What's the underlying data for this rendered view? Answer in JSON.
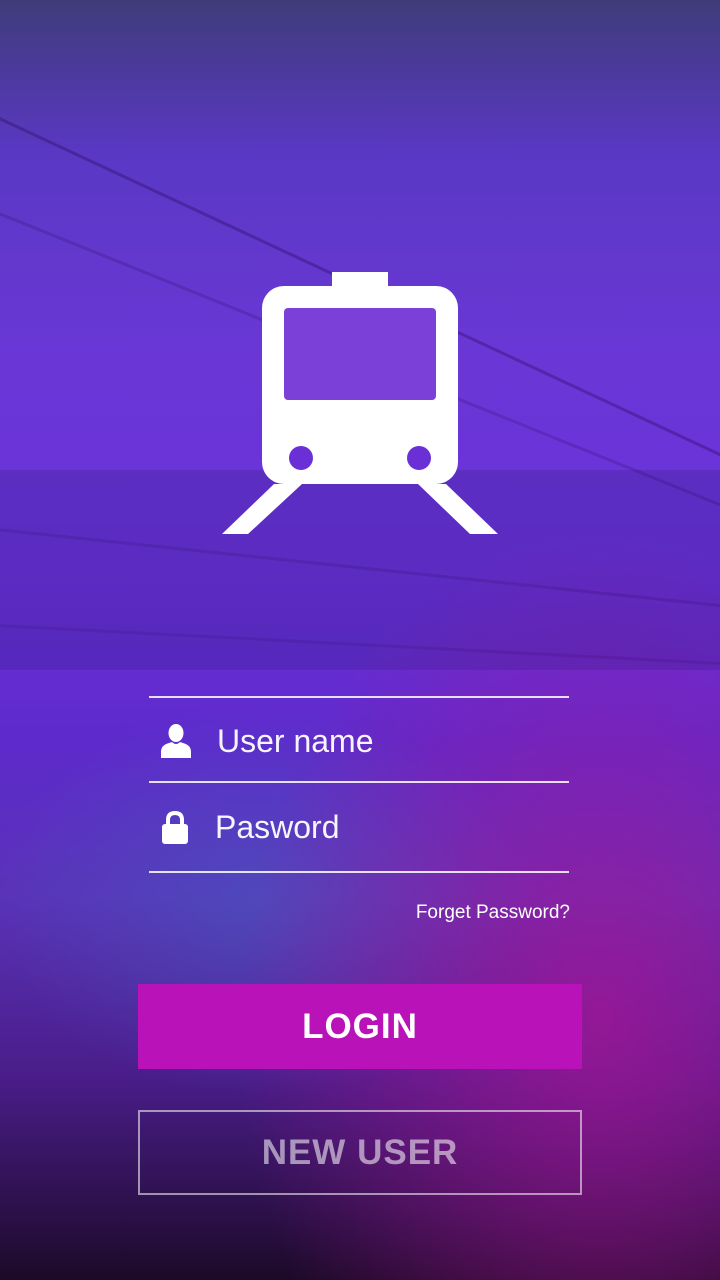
{
  "form": {
    "username_placeholder": "User name",
    "username_value": "",
    "password_placeholder": "Pasword",
    "password_value": "",
    "forgot_label": "Forget Password?"
  },
  "actions": {
    "login_label": "LOGIN",
    "new_user_label": "NEW USER"
  },
  "icons": {
    "logo": "train-icon",
    "username": "user-icon",
    "password": "lock-icon"
  },
  "colors": {
    "login_button": "#b812b8",
    "background_top": "#5a38c4",
    "background_bottom": "#1c0a28"
  }
}
